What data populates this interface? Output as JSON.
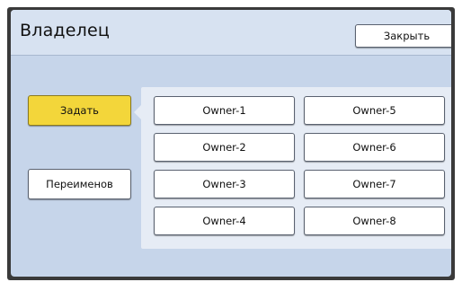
{
  "header": {
    "title": "Владелец",
    "close_label": "Закрыть"
  },
  "side_buttons": {
    "set_label": "Задать",
    "rename_label": "Переименов"
  },
  "owners": [
    "Owner-1",
    "Owner-2",
    "Owner-3",
    "Owner-4",
    "Owner-5",
    "Owner-6",
    "Owner-7",
    "Owner-8"
  ],
  "colors": {
    "selected_button": "#f3d63a",
    "panel_background": "#c6d5ea",
    "list_background": "#e6ecf5"
  }
}
